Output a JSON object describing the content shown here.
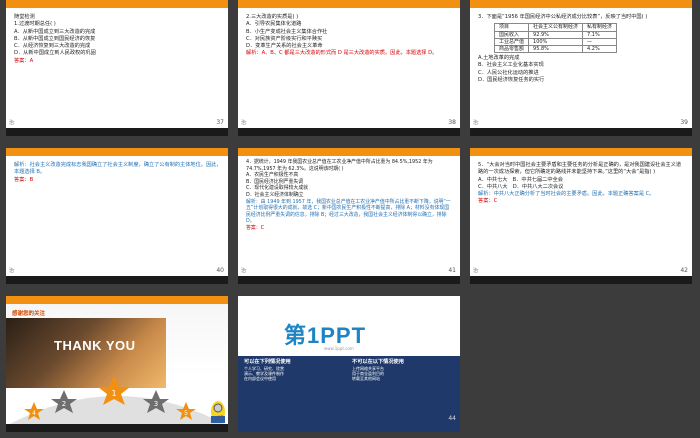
{
  "slides": [
    {
      "id": 37,
      "number": "37",
      "footer": "治",
      "lines": [
        "随堂检测",
        "1.过渡时期总任(    )",
        "A．从新中国成立到三大改造的完成",
        "B．从新中国成立到国民经济的恢复",
        "C．从经济恢复到三大改造的完成",
        "D．从新中国成立到人民政权的巩固"
      ],
      "answer": "答案：A"
    },
    {
      "id": 38,
      "number": "38",
      "footer": "治",
      "lines": [
        "2.三大改造的实质是(    )",
        "A．引导农民集体化道路",
        "B．小生产变成社会主义集体合作社",
        "C．对民族资产阶级实行和平赎买",
        "D．变革生产关系的社会主义革命"
      ],
      "answer": "解析：A、B、C 都是三大改造的形式而 D 是三大改造的实质。因此，本题选择 D。"
    },
    {
      "id": 39,
      "number": "39",
      "footer": "治",
      "intro": "3．下面是“1956 年国民经济中公私经济成分比较表”，反映了当时中国(    )",
      "table": [
        [
          "项目",
          "社会主义公有制经济",
          "私有制经济"
        ],
        [
          "国民收入",
          "92.9%",
          "7.1%"
        ],
        [
          "工业总产值",
          "100%",
          "—"
        ],
        [
          "商品零售额",
          "95.8%",
          "4.2%"
        ]
      ],
      "options": [
        "A.土地改革的完成",
        "B．社会主义工业化基本实现",
        "C．人民公社化运动的推进",
        "D．国民经济恢复任务的实行"
      ]
    },
    {
      "id": 40,
      "number": "40",
      "footer": "治",
      "text": "解析：社会主义改造完成标志我国确立了社会主义制度，确立了公有制的主体地位。因此，本题选择 B。",
      "answer": "答案：B"
    },
    {
      "id": 41,
      "number": "41",
      "footer": "治",
      "lines": [
        "4．据统计，1949 年我国农业总产值在工农业净产值中所占比重为 84.5%,1952 年为 74.7%,1957 年为 62.3%。这说明该时期(    )",
        "A．农民生产积极性不高",
        "B．国民经济比例严重失调",
        "C．现代化建设取得较大成就",
        "D．社会主义经济体制确立"
      ],
      "analysis": "解析：由 1949 年到 1957 年，我国农业总产值在工农业净产值中所占比重不断下降，说明“一五”计划取得很大的成就，故选 C；新中国农民生产积极性不断提高，排除 A；材料没有体现国民经济比例严重失调的信息，排除 B；经过三大改造，我国社会主义经济体制得以确立，排除 D。",
      "answer": "答案：C"
    },
    {
      "id": 42,
      "number": "42",
      "footer": "治",
      "lines": [
        "5．“大会对当时中国社会主要矛盾和主要任务的分析是正确的，是对我国建设社会主义道路的一次成功探索，但它所确定的路线并未能坚持下来。”这里的“大会”是指(    )",
        "A．中共七大　B．中共七届二中全会",
        "C．中共八大　D．中共八大二次会议"
      ],
      "analysis": "解析：中共八大正确分析了当时社会的主要矛盾。因此，本题正确答案是 C。",
      "answer": "答案：C"
    },
    {
      "id": 43,
      "number": "43",
      "heading": "感谢您的关注",
      "thanks": "THANK YOU",
      "stars": [
        "1",
        "2",
        "3",
        "4",
        "5"
      ]
    },
    {
      "id": 44,
      "number": "44",
      "logo": "第1PPT",
      "url": "www.1ppt.com",
      "left_title": "可以在下列情况使用",
      "right_title": "不可以在以下情况使用",
      "left_items": [
        "个人学习、研究、欣赏",
        "演示、教学及课件制作",
        "在内部会议中使用"
      ],
      "right_items": [
        "上传网络共享平台",
        "用于商业盈利目的",
        "转载至其他网站"
      ]
    }
  ],
  "colors": {
    "accent": "#f29111",
    "background": "#3c3c3c",
    "answer": "#d40000",
    "ppt_blue": "#1f3a6a"
  }
}
